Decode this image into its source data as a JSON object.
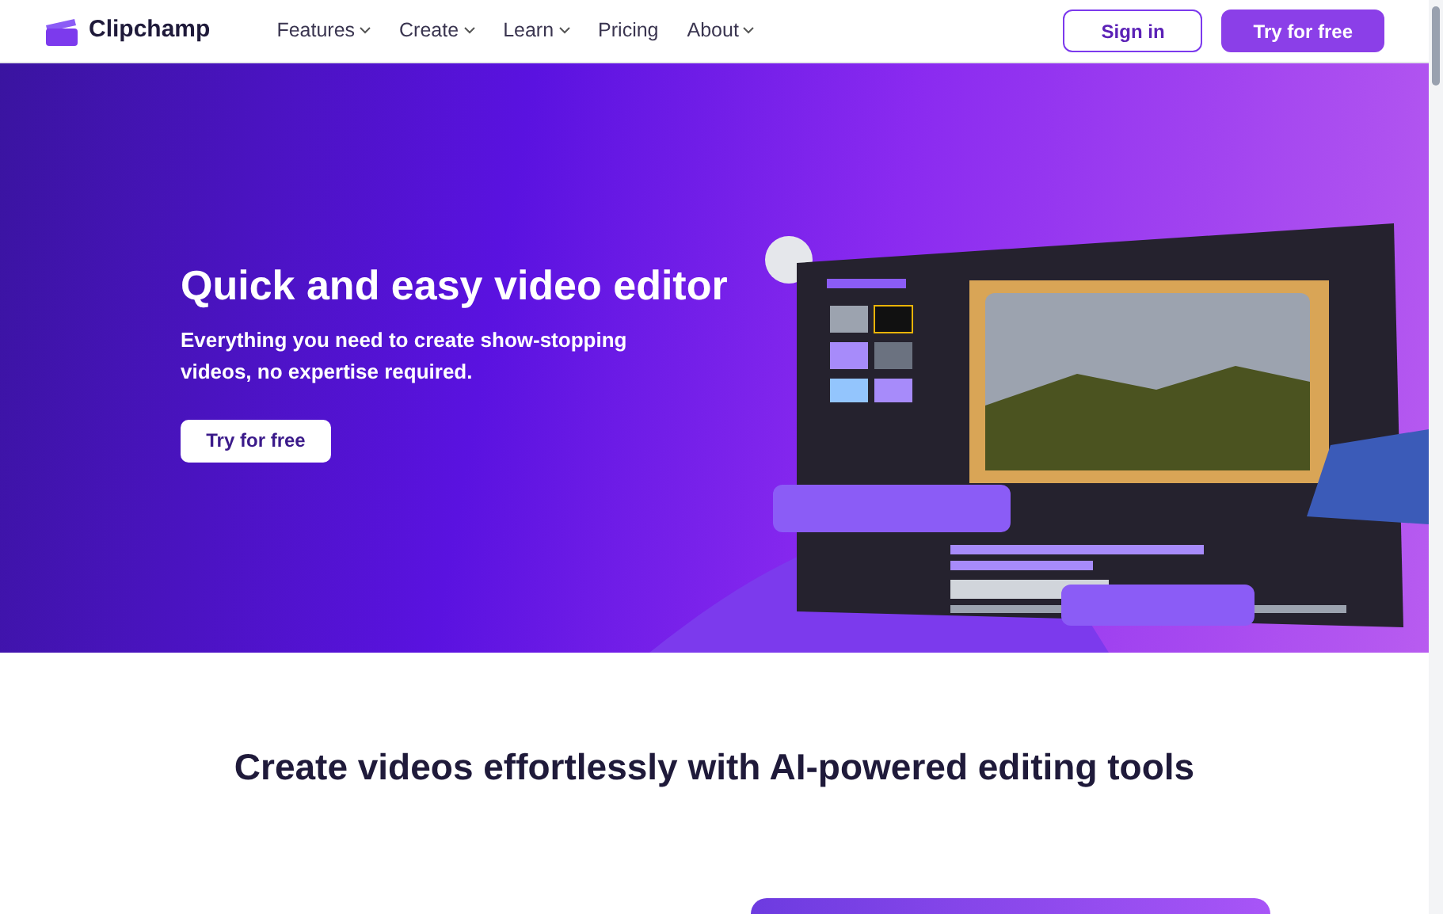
{
  "header": {
    "logo": "Clipchamp",
    "nav": [
      {
        "label": "Features",
        "has_menu": true
      },
      {
        "label": "Create",
        "has_menu": true
      },
      {
        "label": "Learn",
        "has_menu": true
      },
      {
        "label": "Pricing",
        "has_menu": false
      },
      {
        "label": "About",
        "has_menu": true
      }
    ],
    "sign_in": "Sign in",
    "try_free": "Try for free"
  },
  "hero": {
    "title": "Quick and easy video editor",
    "subtitle": "Everything you need to create show-stopping videos, no expertise required.",
    "cta": "Try for free"
  },
  "section": {
    "heading": "Create videos effortlessly with AI-powered editing tools"
  }
}
